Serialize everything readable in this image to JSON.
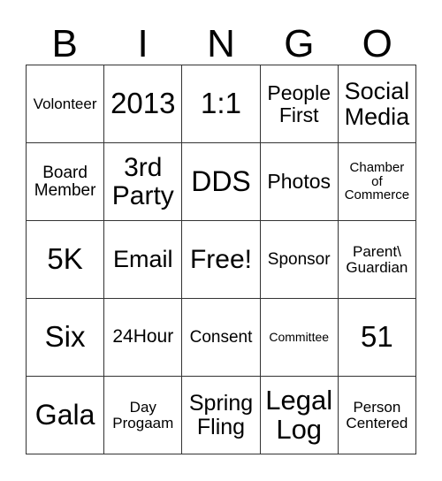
{
  "header": [
    "B",
    "I",
    "N",
    "G",
    "O"
  ],
  "rows": [
    [
      "Volonteer",
      "2013",
      "1:1",
      "People\nFirst",
      "Social\nMedia"
    ],
    [
      "Board\nMember",
      "3rd\nParty",
      "DDS",
      "Photos",
      "Chamber\nof\nCommerce"
    ],
    [
      "5K",
      "Email",
      "Free!",
      "Sponsor",
      "Parent\\\nGuardian"
    ],
    [
      "Six",
      "24Hour",
      "Consent",
      "Committee",
      "51"
    ],
    [
      "Gala",
      "Day\nProgaam",
      "Spring\nFling",
      "Legal\nLog",
      "Person\nCentered"
    ]
  ]
}
